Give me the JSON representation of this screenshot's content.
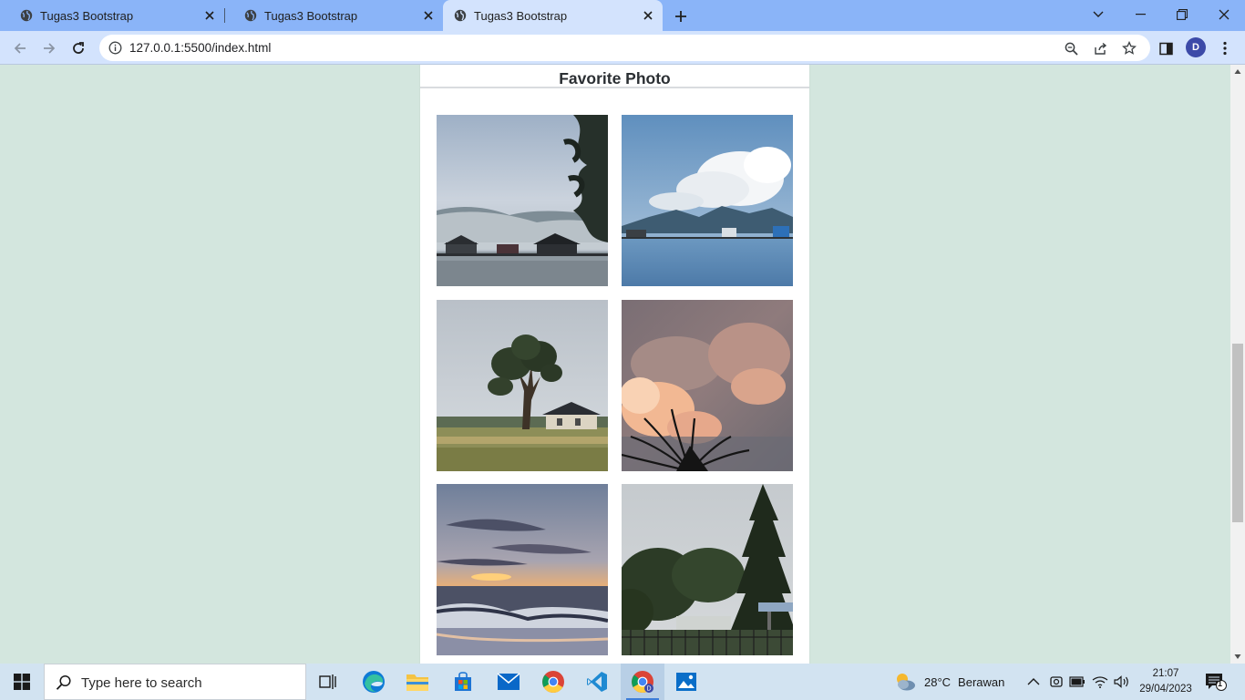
{
  "browser": {
    "tabs": [
      {
        "title": "Tugas3 Bootstrap",
        "active": false
      },
      {
        "title": "Tugas3 Bootstrap",
        "active": false
      },
      {
        "title": "Tugas3 Bootstrap",
        "active": true
      }
    ],
    "url": "127.0.0.1:5500/index.html",
    "profile_initial": "D",
    "icons": [
      "back-icon",
      "forward-icon",
      "reload-icon",
      "info-icon",
      "zoom-icon",
      "share-icon",
      "star-icon",
      "side-panel-icon",
      "menu-icon"
    ]
  },
  "page": {
    "card_title": "Favorite Photo",
    "photos": [
      {
        "name": "lake-with-tree"
      },
      {
        "name": "lake-with-clouds"
      },
      {
        "name": "tree-in-rice-field"
      },
      {
        "name": "sunset-clouds-palm"
      },
      {
        "name": "beach-sunset"
      },
      {
        "name": "park-with-pine-tree"
      }
    ],
    "background_color": "#d3e6de"
  },
  "taskbar": {
    "search_placeholder": "Type here to search",
    "weather_temp": "28°C",
    "weather_desc": "Berawan",
    "time": "21:07",
    "date": "29/04/2023",
    "notification_count": "1",
    "apps": [
      "task-view",
      "edge",
      "file-explorer",
      "microsoft-store",
      "mail",
      "chrome",
      "vscode",
      "chrome-profile",
      "photos"
    ]
  }
}
